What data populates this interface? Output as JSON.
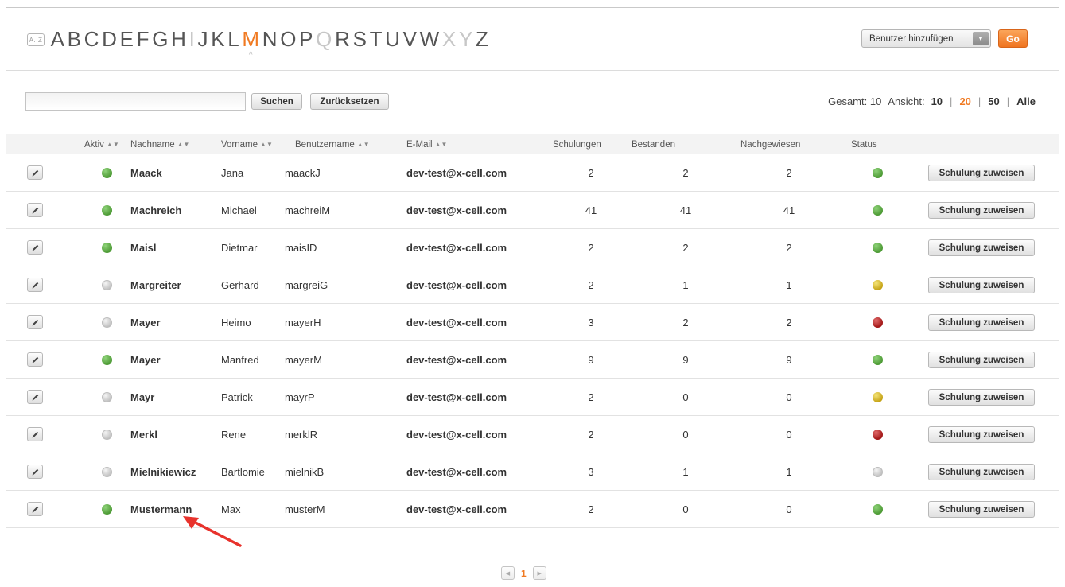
{
  "alphabet": {
    "az_icon_label": "A..Z",
    "letters": [
      {
        "l": "A",
        "state": "normal"
      },
      {
        "l": "B",
        "state": "normal"
      },
      {
        "l": "C",
        "state": "normal"
      },
      {
        "l": "D",
        "state": "normal"
      },
      {
        "l": "E",
        "state": "normal"
      },
      {
        "l": "F",
        "state": "normal"
      },
      {
        "l": "G",
        "state": "normal"
      },
      {
        "l": "H",
        "state": "normal"
      },
      {
        "l": "I",
        "state": "disabled"
      },
      {
        "l": "J",
        "state": "normal"
      },
      {
        "l": "K",
        "state": "normal"
      },
      {
        "l": "L",
        "state": "normal"
      },
      {
        "l": "M",
        "state": "active"
      },
      {
        "l": "N",
        "state": "normal"
      },
      {
        "l": "O",
        "state": "normal"
      },
      {
        "l": "P",
        "state": "normal"
      },
      {
        "l": "Q",
        "state": "disabled"
      },
      {
        "l": "R",
        "state": "normal"
      },
      {
        "l": "S",
        "state": "normal"
      },
      {
        "l": "T",
        "state": "normal"
      },
      {
        "l": "U",
        "state": "normal"
      },
      {
        "l": "V",
        "state": "normal"
      },
      {
        "l": "W",
        "state": "normal"
      },
      {
        "l": "X",
        "state": "disabled"
      },
      {
        "l": "Y",
        "state": "disabled"
      },
      {
        "l": "Z",
        "state": "normal"
      }
    ]
  },
  "actions": {
    "add_select_value": "Benutzer hinzufügen",
    "go_label": "Go"
  },
  "search": {
    "value": "",
    "placeholder": "",
    "search_label": "Suchen",
    "reset_label": "Zurücksetzen"
  },
  "totals": {
    "total_label": "Gesamt:",
    "total_value": "10",
    "view_label": "Ansicht:",
    "options": [
      "10",
      "20",
      "50",
      "Alle"
    ],
    "current": "20"
  },
  "table": {
    "headers": {
      "aktiv": "Aktiv",
      "nachname": "Nachname",
      "vorname": "Vorname",
      "benutzername": "Benutzername",
      "email": "E-Mail",
      "schulungen": "Schulungen",
      "bestanden": "Bestanden",
      "nachgewiesen": "Nachgewiesen",
      "status": "Status"
    },
    "assign_label": "Schulung zuweisen",
    "rows": [
      {
        "aktiv": "green",
        "nachname": "Maack",
        "vorname": "Jana",
        "benutzername": "maackJ",
        "email": "dev-test@x-cell.com",
        "schulungen": "2",
        "bestanden": "2",
        "nachgewiesen": "2",
        "status": "green"
      },
      {
        "aktiv": "green",
        "nachname": "Machreich",
        "vorname": "Michael",
        "benutzername": "machreiM",
        "email": "dev-test@x-cell.com",
        "schulungen": "41",
        "bestanden": "41",
        "nachgewiesen": "41",
        "status": "green"
      },
      {
        "aktiv": "green",
        "nachname": "Maisl",
        "vorname": "Dietmar",
        "benutzername": "maisID",
        "email": "dev-test@x-cell.com",
        "schulungen": "2",
        "bestanden": "2",
        "nachgewiesen": "2",
        "status": "green"
      },
      {
        "aktiv": "grey",
        "nachname": "Margreiter",
        "vorname": "Gerhard",
        "benutzername": "margreiG",
        "email": "dev-test@x-cell.com",
        "schulungen": "2",
        "bestanden": "1",
        "nachgewiesen": "1",
        "status": "yellow"
      },
      {
        "aktiv": "grey",
        "nachname": "Mayer",
        "vorname": "Heimo",
        "benutzername": "mayerH",
        "email": "dev-test@x-cell.com",
        "schulungen": "3",
        "bestanden": "2",
        "nachgewiesen": "2",
        "status": "red"
      },
      {
        "aktiv": "green",
        "nachname": "Mayer",
        "vorname": "Manfred",
        "benutzername": "mayerM",
        "email": "dev-test@x-cell.com",
        "schulungen": "9",
        "bestanden": "9",
        "nachgewiesen": "9",
        "status": "green"
      },
      {
        "aktiv": "grey",
        "nachname": "Mayr",
        "vorname": "Patrick",
        "benutzername": "mayrP",
        "email": "dev-test@x-cell.com",
        "schulungen": "2",
        "bestanden": "0",
        "nachgewiesen": "0",
        "status": "yellow"
      },
      {
        "aktiv": "grey",
        "nachname": "Merkl",
        "vorname": "Rene",
        "benutzername": "merklR",
        "email": "dev-test@x-cell.com",
        "schulungen": "2",
        "bestanden": "0",
        "nachgewiesen": "0",
        "status": "red"
      },
      {
        "aktiv": "grey",
        "nachname": "Mielnikiewicz",
        "vorname": "Bartlomie",
        "benutzername": "mielnikB",
        "email": "dev-test@x-cell.com",
        "schulungen": "3",
        "bestanden": "1",
        "nachgewiesen": "1",
        "status": "grey"
      },
      {
        "aktiv": "green",
        "nachname": "Mustermann",
        "vorname": "Max",
        "benutzername": "musterM",
        "email": "dev-test@x-cell.com",
        "schulungen": "2",
        "bestanden": "0",
        "nachgewiesen": "0",
        "status": "green"
      }
    ]
  },
  "pager": {
    "current_page": "1"
  },
  "colors": {
    "accent": "#f07a22",
    "annotation_arrow": "#e8322c"
  }
}
